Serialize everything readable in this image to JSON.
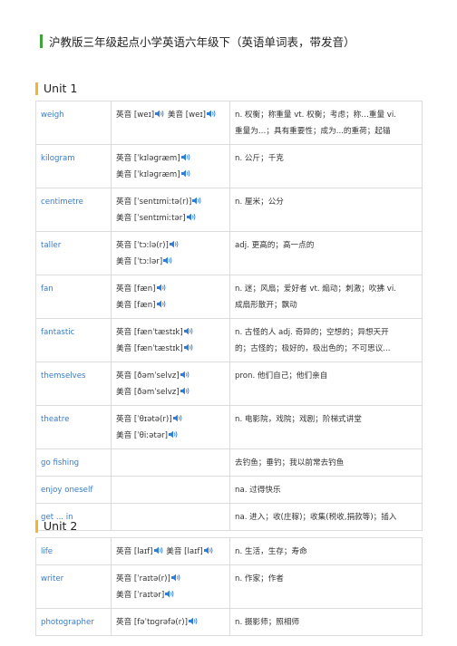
{
  "title": "沪教版三年级起点小学英语六年级下（英语单词表，带发音）",
  "units": [
    {
      "label": "Unit 1",
      "entries": [
        {
          "word": "weigh",
          "pron": [
            "英音 [weɪ]",
            "美音 [weɪ]"
          ],
          "pron_inline": true,
          "meaning": [
            "n. 权衡；称重量 vt. 权衡；考虑；称…重量 vi.",
            "重量为…；具有重要性；成为...的重荷；起锚"
          ]
        },
        {
          "word": "kilogram",
          "pron": [
            "英音 [ˈkɪləɡræm]",
            "美音 [ˈkɪləɡræm]"
          ],
          "meaning": [
            "n. 公斤；千克"
          ]
        },
        {
          "word": "centimetre",
          "pron": [
            "英音 [ˈsentɪmiːtə(r)]",
            "美音 [ˈsentɪmiːtər]"
          ],
          "meaning": [
            "n. 厘米；公分"
          ]
        },
        {
          "word": "taller",
          "pron": [
            "英音 [ˈtɔːlə(r)]",
            "美音 [ˈtɔːlər]"
          ],
          "meaning": [
            "adj. 更高的；高一点的"
          ]
        },
        {
          "word": "fan",
          "pron": [
            "英音 [fæn]",
            "美音 [fæn]"
          ],
          "meaning": [
            "n. 迷；风扇；爱好者 vt. 煽动；刺激；吹拂 vi.",
            "成扇形散开；飘动"
          ]
        },
        {
          "word": "fantastic",
          "pron": [
            "英音 [fænˈtæstɪk]",
            "美音 [fænˈtæstɪk]"
          ],
          "meaning": [
            "n. 古怪的人 adj. 奇异的；空想的；异想天开",
            "的；古怪的；极好的，极出色的；不可思议..."
          ]
        },
        {
          "word": "themselves",
          "pron": [
            "英音 [ðəmˈselvz]",
            "美音 [ðəmˈselvz]"
          ],
          "meaning": [
            "pron. 他们自己；他们亲自"
          ]
        },
        {
          "word": "theatre",
          "pron": [
            "英音 [ˈθɪətə(r)]",
            "美音 [ˈθiːətər]"
          ],
          "meaning": [
            "n. 电影院，戏院；戏剧；阶梯式讲堂"
          ]
        },
        {
          "word": "go fishing",
          "pron": [],
          "meaning": [
            "去钓鱼；垂钓；我以前常去钓鱼"
          ]
        },
        {
          "word": "enjoy oneself",
          "pron": [],
          "meaning": [
            "na. 过得快乐"
          ]
        },
        {
          "word": "get ... in",
          "pron": [],
          "meaning": [
            "na. 进入；收(庄稼)；收集(税收,捐款等)；插入"
          ]
        }
      ]
    },
    {
      "label": "Unit 2",
      "entries": [
        {
          "word": "life",
          "pron": [
            "英音 [laɪf]",
            "美音 [laɪf]"
          ],
          "pron_inline": true,
          "meaning": [
            "n. 生活，生存；寿命"
          ]
        },
        {
          "word": "writer",
          "pron": [
            "英音 [ˈraɪtə(r)]",
            "美音 [ˈraɪtər]"
          ],
          "meaning": [
            "n. 作家；作者"
          ]
        },
        {
          "word": "photographer",
          "pron": [
            "英音 [fəˈtɒɡrəfə(r)]"
          ],
          "meaning": [
            "n. 摄影师；照相师"
          ]
        }
      ]
    }
  ],
  "colors": {
    "accent_green": "#3ea43a",
    "accent_yellow": "#f1b72b",
    "word_blue": "#3a7bc8",
    "speaker_blue": "#2f7fd8"
  },
  "icons": {
    "pronunciation": "speaker-icon"
  }
}
